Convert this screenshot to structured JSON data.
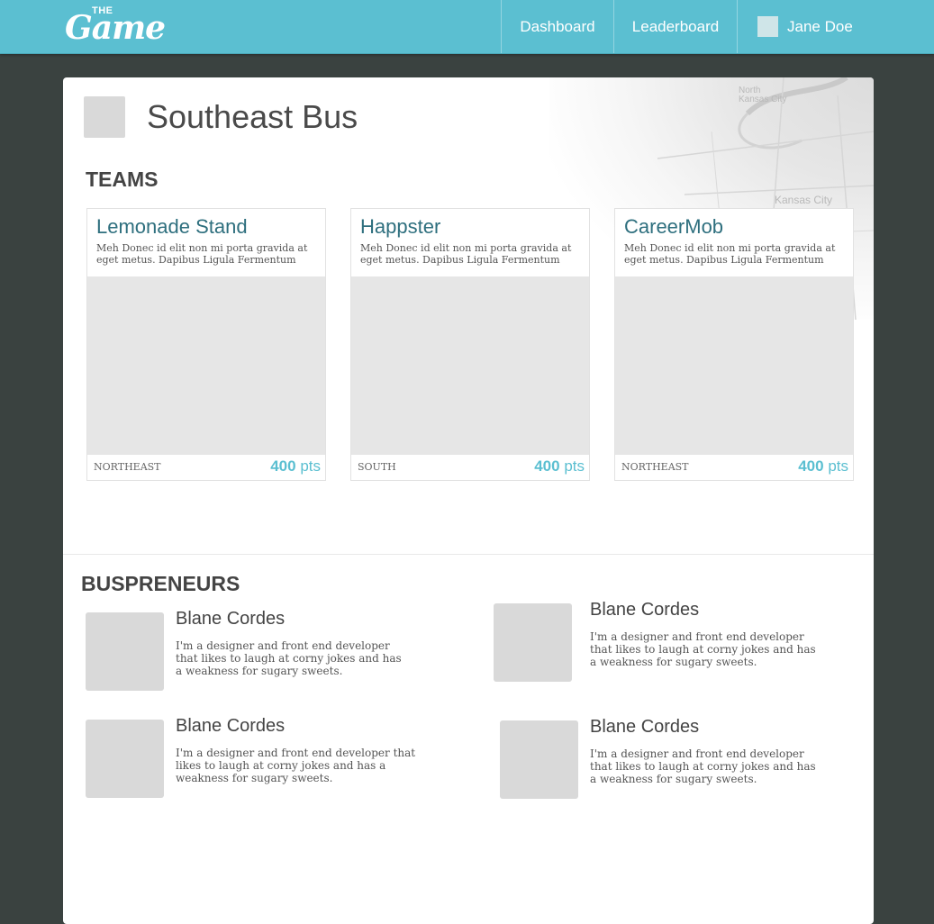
{
  "header": {
    "logo_small": "THE",
    "logo_main": "Game",
    "nav": {
      "dashboard": "Dashboard",
      "leaderboard": "Leaderboard"
    },
    "user_name": "Jane Doe",
    "brand_color": "#5bbfd1"
  },
  "bus": {
    "title": "Southeast Bus"
  },
  "map_labels": {
    "north_kc": "North Kansas City",
    "kc": "Kansas City"
  },
  "teams_heading": "TEAMS",
  "teams": [
    {
      "name": "Lemonade Stand",
      "description": "Meh Donec id elit non mi porta gravida at eget metus. Dapibus Ligula Fermentum",
      "region": "NORTHEAST",
      "points": "400",
      "points_unit": "pts"
    },
    {
      "name": "Happster",
      "description": "Meh Donec id elit non mi porta gravida at eget metus. Dapibus Ligula Fermentum",
      "region": "SOUTH",
      "points": "400",
      "points_unit": "pts"
    },
    {
      "name": "CareerMob",
      "description": "Meh Donec id elit non mi porta gravida at eget metus. Dapibus Ligula Fermentum",
      "region": "NORTHEAST",
      "points": "400",
      "points_unit": "pts"
    }
  ],
  "buspreneurs_heading": "BUSPRENEURS",
  "buspreneurs": [
    {
      "name": "Blane Cordes",
      "bio": "I'm a designer and front end developer that likes to laugh at corny jokes and has a weakness for sugary sweets."
    },
    {
      "name": "Blane Cordes",
      "bio": "I'm a designer and front end developer that likes to laugh at corny jokes and has a weakness for sugary sweets."
    },
    {
      "name": "Blane Cordes",
      "bio": "I'm a designer and front end developer that likes to laugh at corny jokes and has a weakness for sugary sweets."
    },
    {
      "name": "Blane Cordes",
      "bio": "I'm a designer and front end developer that likes to laugh at corny jokes and has a weakness for sugary sweets."
    }
  ]
}
